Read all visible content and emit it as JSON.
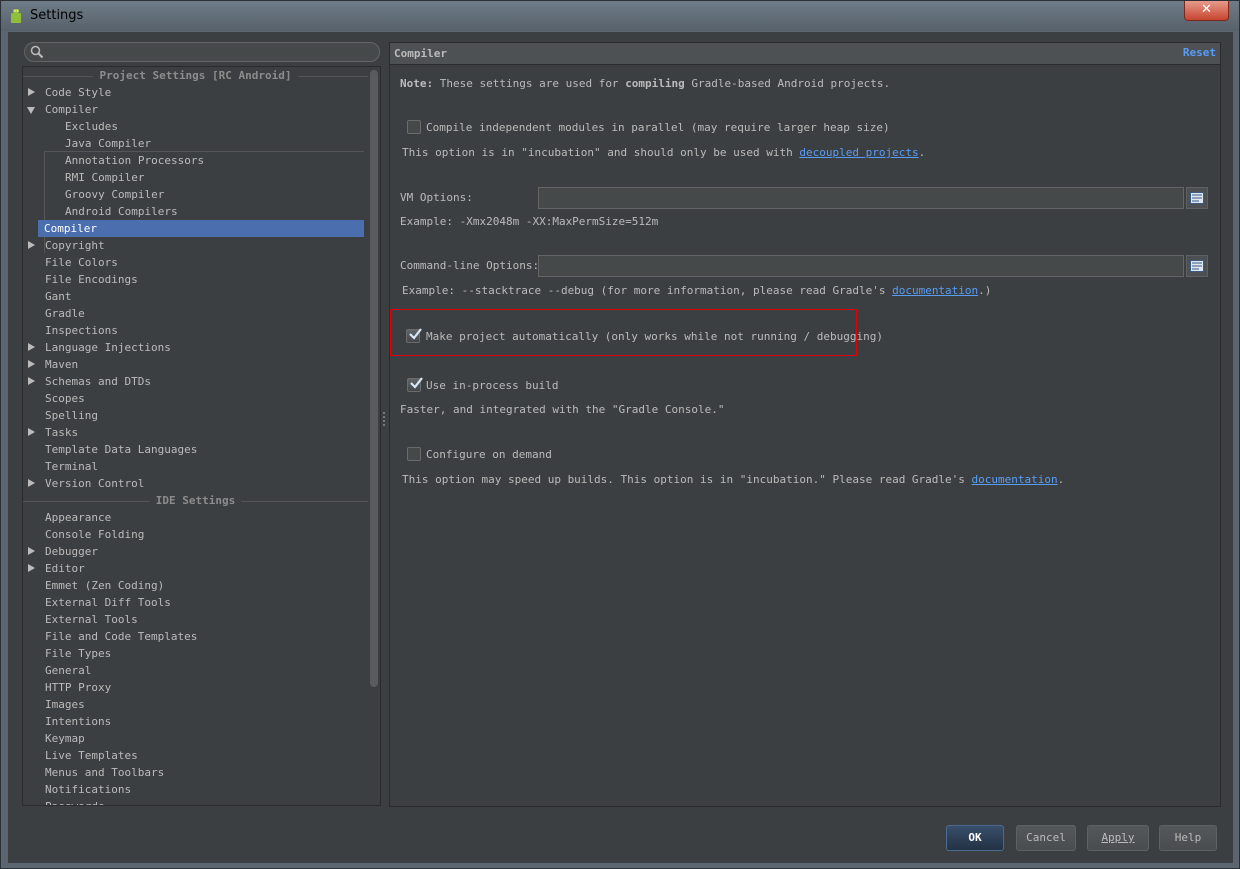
{
  "window": {
    "title": "Settings",
    "close_glyph": "✕"
  },
  "search": {
    "placeholder": "",
    "value": ""
  },
  "tree": {
    "project_section": "Project Settings [RC Android]",
    "ide_section": "IDE Settings",
    "items": [
      {
        "label": "Code Style",
        "arrow": "right"
      },
      {
        "label": "Compiler",
        "arrow": "down"
      },
      {
        "label": "Excludes",
        "indent": 1
      },
      {
        "label": "Java Compiler",
        "indent": 1
      },
      {
        "label": "Annotation Processors",
        "indent": 1
      },
      {
        "label": "RMI Compiler",
        "indent": 1
      },
      {
        "label": "Groovy Compiler",
        "indent": 1
      },
      {
        "label": "Android Compilers",
        "indent": 1
      },
      {
        "label": "Compiler",
        "selected": true
      },
      {
        "label": "Copyright",
        "arrow": "right"
      },
      {
        "label": "File Colors"
      },
      {
        "label": "File Encodings"
      },
      {
        "label": "Gant"
      },
      {
        "label": "Gradle"
      },
      {
        "label": "Inspections"
      },
      {
        "label": "Language Injections",
        "arrow": "right"
      },
      {
        "label": "Maven",
        "arrow": "right"
      },
      {
        "label": "Schemas and DTDs",
        "arrow": "right"
      },
      {
        "label": "Scopes"
      },
      {
        "label": "Spelling"
      },
      {
        "label": "Tasks",
        "arrow": "right"
      },
      {
        "label": "Template Data Languages"
      },
      {
        "label": "Terminal"
      },
      {
        "label": "Version Control",
        "arrow": "right"
      }
    ],
    "ide_items": [
      {
        "label": "Appearance"
      },
      {
        "label": "Console Folding"
      },
      {
        "label": "Debugger",
        "arrow": "right"
      },
      {
        "label": "Editor",
        "arrow": "right"
      },
      {
        "label": "Emmet (Zen Coding)"
      },
      {
        "label": "External Diff Tools"
      },
      {
        "label": "External Tools"
      },
      {
        "label": "File and Code Templates"
      },
      {
        "label": "File Types"
      },
      {
        "label": "General"
      },
      {
        "label": "HTTP Proxy"
      },
      {
        "label": "Images"
      },
      {
        "label": "Intentions"
      },
      {
        "label": "Keymap"
      },
      {
        "label": "Live Templates"
      },
      {
        "label": "Menus and Toolbars"
      },
      {
        "label": "Notifications"
      },
      {
        "label": "Passwords"
      }
    ]
  },
  "panel": {
    "title": "Compiler",
    "reset_label": "Reset",
    "note_label": "Note:",
    "note_pre": "These settings are used for",
    "note_bold": "compiling",
    "note_post": "Gradle-based Android projects.",
    "parallel_label": "Compile independent modules in parallel (may require larger heap size)",
    "parallel_checked": false,
    "incubation_text": "This option is in \"incubation\" and should only be used with",
    "decoupled_link": "decoupled projects",
    "decoupled_suffix": ".",
    "vm_label": "VM Options:",
    "vm_value": "",
    "vm_example": "Example: -Xmx2048m -XX:MaxPermSize=512m",
    "cmd_label": "Command-line Options:",
    "cmd_value": "",
    "cmd_example": "Example: --stacktrace --debug (for more information, please read Gradle's",
    "cmd_doc_link": "documentation",
    "cmd_doc_suffix": ".)",
    "make_auto_label": "Make project automatically (only works while not running / debugging)",
    "make_auto_checked": true,
    "in_process_label": "Use in-process build",
    "in_process_checked": true,
    "in_process_desc": "Faster, and integrated with the \"Gradle Console.\"",
    "on_demand_label": "Configure on demand",
    "on_demand_checked": false,
    "on_demand_desc": "This option may speed up builds. This option is in \"incubation.\" Please read Gradle's",
    "on_demand_doc_link": "documentation",
    "on_demand_doc_suffix": "."
  },
  "buttons": {
    "ok": "OK",
    "cancel": "Cancel",
    "apply": "Apply",
    "help": "Help"
  },
  "colors": {
    "selection": "#4b6eaf",
    "link": "#589df6",
    "highlight_border": "#e00000",
    "panel_bg": "#3c3f41"
  }
}
